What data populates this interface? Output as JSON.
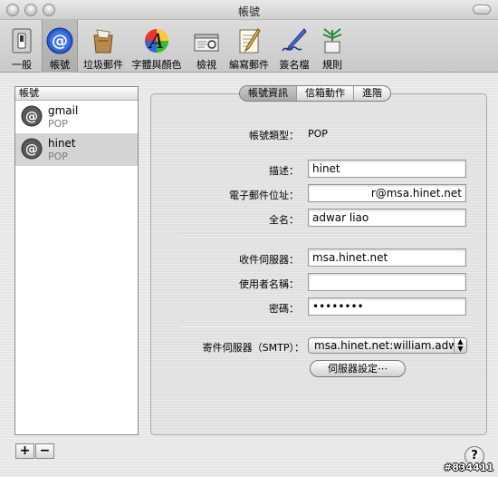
{
  "window": {
    "title": "帳號"
  },
  "toolbar": [
    {
      "label": "一般",
      "icon": "switch-icon"
    },
    {
      "label": "帳號",
      "icon": "at-sign-icon"
    },
    {
      "label": "垃圾郵件",
      "icon": "junk-mail-icon"
    },
    {
      "label": "字體與顏色",
      "icon": "fonts-colors-icon"
    },
    {
      "label": "檢視",
      "icon": "viewing-icon"
    },
    {
      "label": "編寫郵件",
      "icon": "composing-icon"
    },
    {
      "label": "簽名檔",
      "icon": "signature-icon"
    },
    {
      "label": "規則",
      "icon": "rules-icon"
    }
  ],
  "accounts": {
    "header": "帳號",
    "items": [
      {
        "name": "gmail",
        "type": "POP"
      },
      {
        "name": "hinet",
        "type": "POP"
      }
    ]
  },
  "tabs": [
    "帳號資訊",
    "信箱動作",
    "進階"
  ],
  "form": {
    "account_type_label": "帳號類型：",
    "account_type_value": "POP",
    "description_label": "描述：",
    "description_value": "hinet",
    "email_label": "電子郵件位址：",
    "email_value": "r@msa.hinet.net",
    "fullname_label": "全名：",
    "fullname_value": "adwar liao",
    "incoming_label": "收件伺服器：",
    "incoming_value": "msa.hinet.net",
    "username_label": "使用者名稱：",
    "username_value": "",
    "password_label": "密碼：",
    "password_value": "••••••••",
    "smtp_label": "寄件伺服器（SMTP）：",
    "smtp_value": "msa.hinet.net:william.adwa",
    "server_settings_button": "伺服器設定⋯"
  },
  "controls": {
    "add": "+",
    "remove": "−",
    "help": "?"
  },
  "watermark": "#834411"
}
